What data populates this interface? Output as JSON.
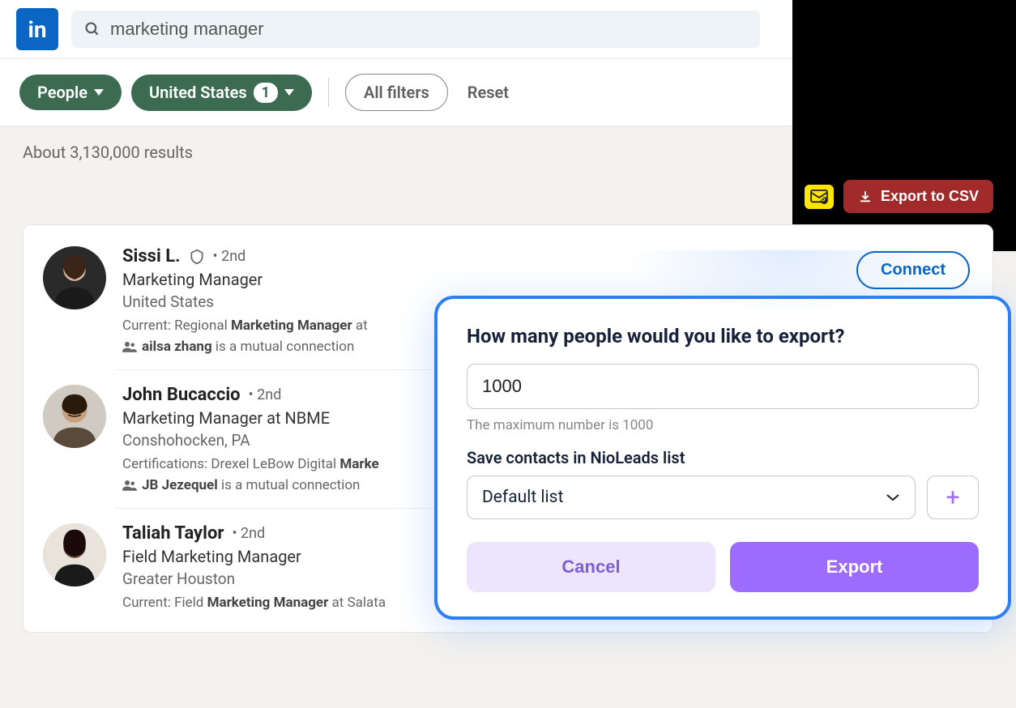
{
  "search": {
    "query": "marketing manager"
  },
  "filters": {
    "people": "People",
    "location": "United States",
    "location_count": "1",
    "all_filters": "All filters",
    "reset": "Reset"
  },
  "results": {
    "count_text": "About 3,130,000 results",
    "export_label": "Export to CSV"
  },
  "people": [
    {
      "name": "Sissi L.",
      "degree": "2nd",
      "title": "Marketing Manager",
      "location": "United States",
      "subline_prefix": "Current: Regional ",
      "subline_bold": "Marketing Manager",
      "subline_suffix": " at ",
      "mutual_name": "ailsa zhang",
      "mutual_suffix": " is a mutual connection",
      "connect": "Connect",
      "verified": true
    },
    {
      "name": "John Bucaccio",
      "degree": "2nd",
      "title": "Marketing Manager at NBME",
      "location": "Conshohocken, PA",
      "subline_prefix": "Certifications: Drexel LeBow Digital ",
      "subline_bold": "Marke",
      "subline_suffix": "",
      "mutual_name": "JB Jezequel",
      "mutual_suffix": " is a mutual connection"
    },
    {
      "name": "Taliah Taylor",
      "degree": "2nd",
      "title": "Field Marketing Manager",
      "location": "Greater Houston",
      "subline_prefix": "Current: Field ",
      "subline_bold": "Marketing Manager",
      "subline_suffix": " at Salata"
    }
  ],
  "modal": {
    "heading": "How many people would you like to export?",
    "input_value": "1000",
    "hint": "The maximum number is 1000",
    "save_label": "Save contacts in NioLeads list",
    "list_value": "Default list",
    "cancel": "Cancel",
    "export": "Export"
  }
}
